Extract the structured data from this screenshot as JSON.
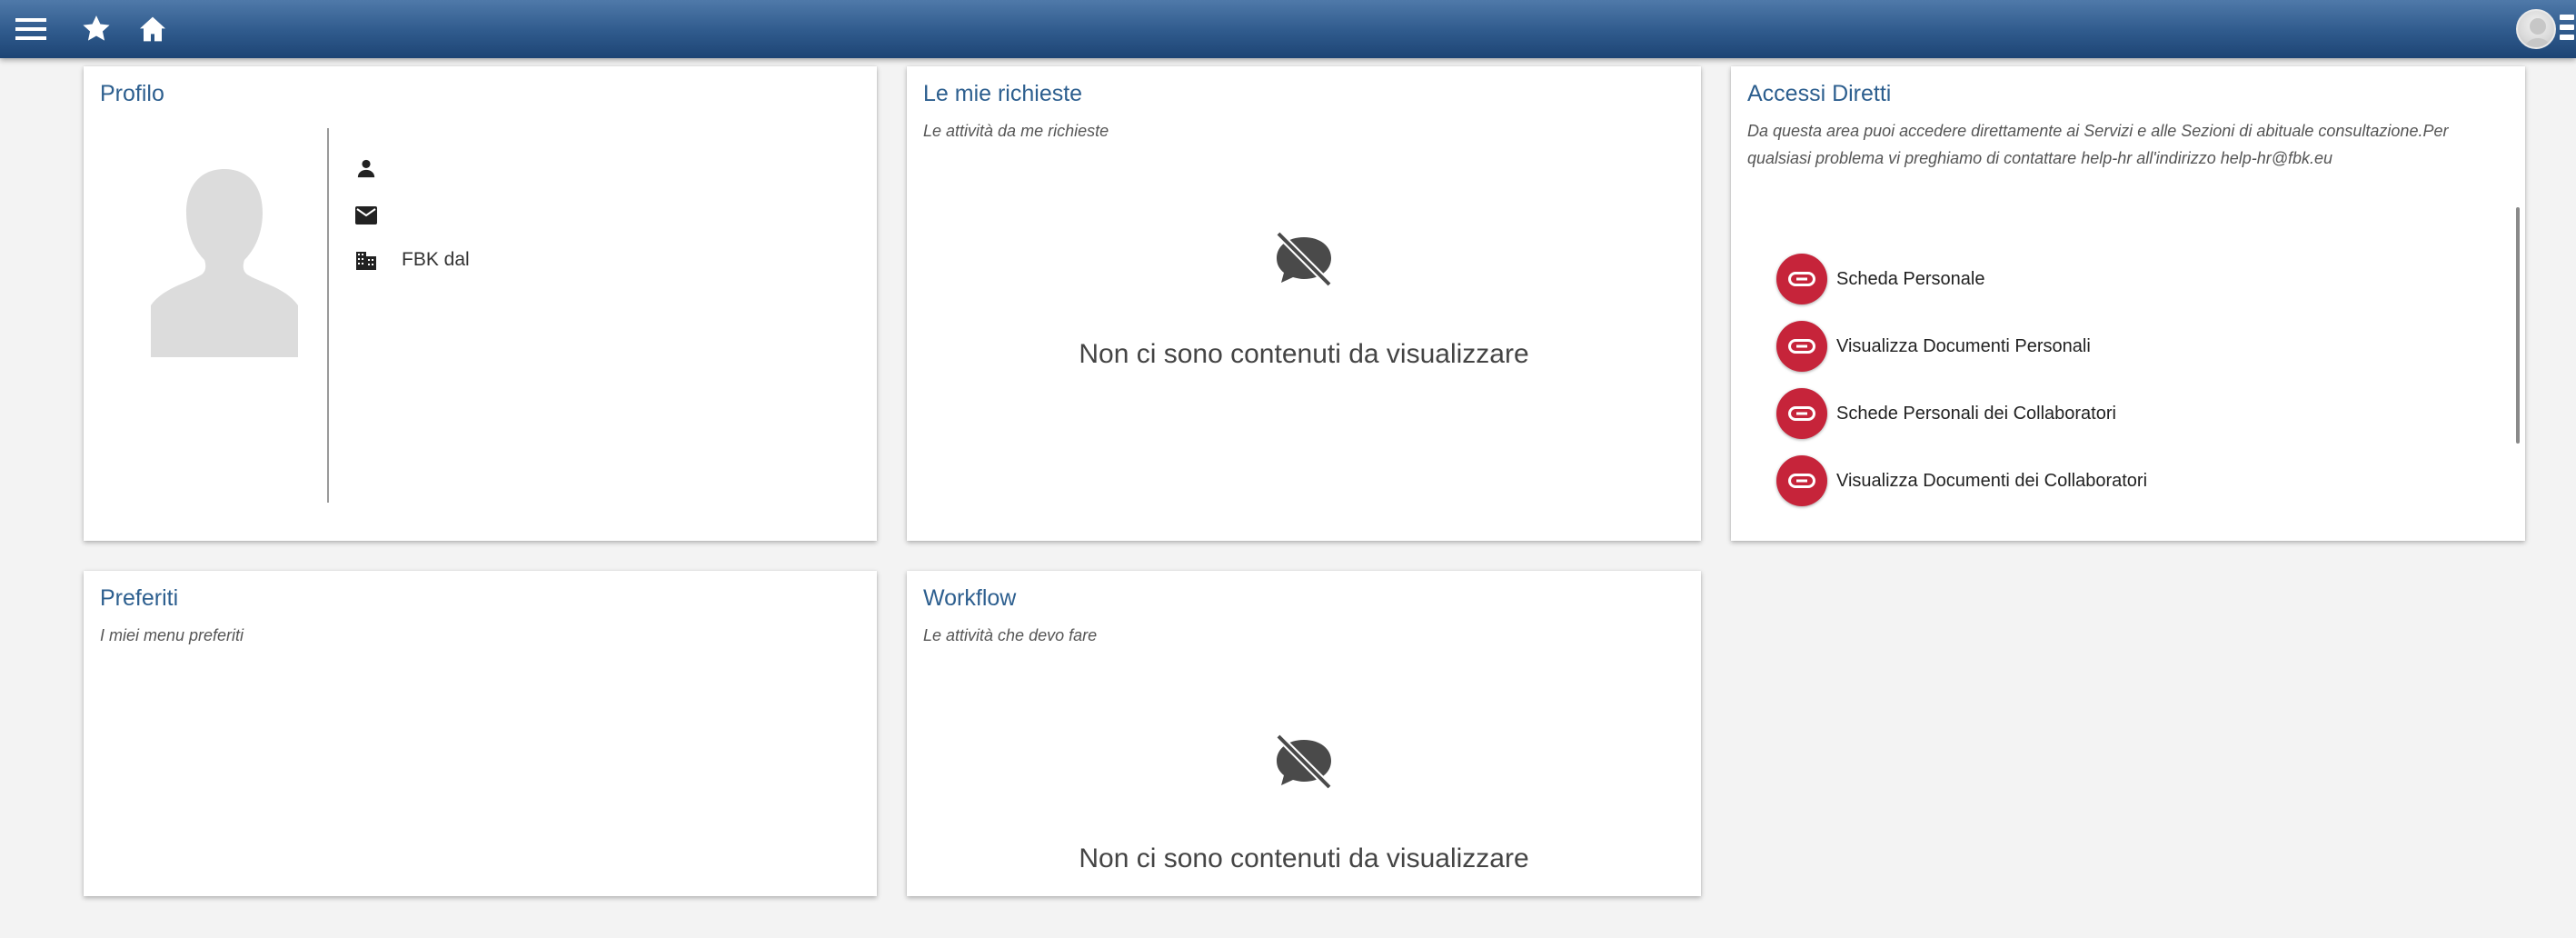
{
  "topbar": {
    "menu_icon": "hamburger-menu-icon",
    "star_icon": "star-icon",
    "home_icon": "home-icon",
    "avatar_icon": "user-avatar-icon"
  },
  "profilo": {
    "title": "Profilo",
    "rows": [
      {
        "icon": "person-icon",
        "text": ""
      },
      {
        "icon": "email-icon",
        "text": ""
      },
      {
        "icon": "building-icon",
        "text": "FBK dal"
      }
    ]
  },
  "richieste": {
    "title": "Le mie richieste",
    "subtitle": "Le attività da me richieste",
    "empty_text": "Non ci sono contenuti da visualizzare"
  },
  "accessi": {
    "title": "Accessi Diretti",
    "subtitle": "Da questa area puoi accedere direttamente ai Servizi e alle Sezioni di abituale consultazione.Per qualsiasi problema vi preghiamo di contattare help-hr all'indirizzo help-hr@fbk.eu",
    "items": [
      {
        "label": "Scheda Personale"
      },
      {
        "label": "Visualizza Documenti Personali"
      },
      {
        "label": "Schede Personali dei Collaboratori"
      },
      {
        "label": "Visualizza Documenti dei Collaboratori"
      }
    ]
  },
  "preferiti": {
    "title": "Preferiti",
    "subtitle": "I miei menu preferiti"
  },
  "workflow": {
    "title": "Workflow",
    "subtitle": "Le attività che devo fare",
    "empty_text": "Non ci sono contenuti da visualizzare"
  },
  "colors": {
    "topbar": "#2f5a8c",
    "title": "#2d5f8f",
    "accent": "#c6243a",
    "background": "#f3f3f3"
  }
}
